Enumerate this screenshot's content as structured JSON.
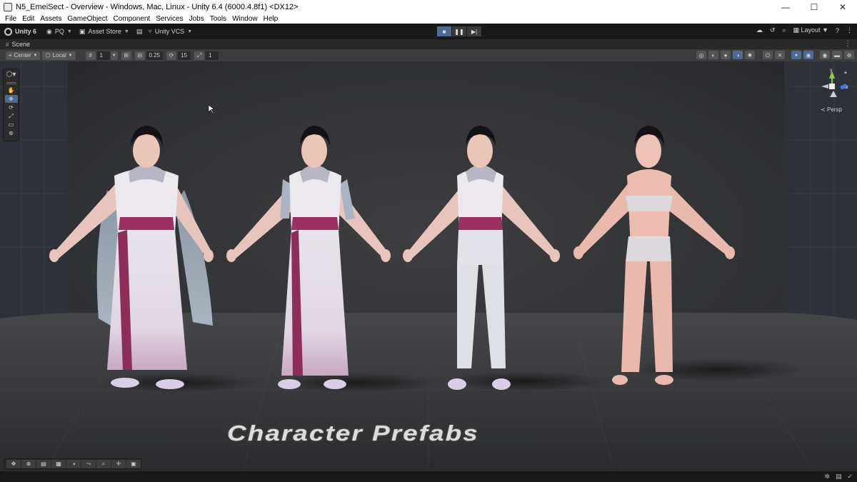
{
  "window": {
    "title": "N5_EmeiSect - Overview - Windows, Mac, Linux - Unity 6.4 (6000.4.8f1) <DX12>",
    "minimize": "—",
    "maximize": "☐",
    "close": "✕"
  },
  "menu": [
    "File",
    "Edit",
    "Assets",
    "GameObject",
    "Component",
    "Services",
    "Jobs",
    "Tools",
    "Window",
    "Help"
  ],
  "toolbar": {
    "unity_label": "Unity 6",
    "account_label": "PQ",
    "asset_store_label": "Asset Store",
    "vcs_label": "Unity VCS",
    "layout_label": "Layout",
    "play_icons": [
      "play-icon",
      "pause-icon",
      "step-icon"
    ]
  },
  "scene_tab": {
    "label": "Scene"
  },
  "scene_toolbar": {
    "pivot_label": "Center",
    "space_label": "Local",
    "grid_value": "1",
    "snap_move": "0.25",
    "snap_rotate": "15",
    "snap_scale": "1"
  },
  "gizmo": {
    "projection_label": "Persp",
    "axes": {
      "y": "y",
      "z": "z"
    },
    "colors": {
      "x": "#d9433a",
      "y": "#8ccf3a",
      "z": "#4477d8"
    }
  },
  "scene": {
    "title_text": "Character Prefabs",
    "characters": [
      "robed-with-cape",
      "robed",
      "trousers",
      "base-body"
    ]
  },
  "colors": {
    "accent": "#4d6a92",
    "background": "#191919",
    "panel": "#3c3c3c"
  }
}
